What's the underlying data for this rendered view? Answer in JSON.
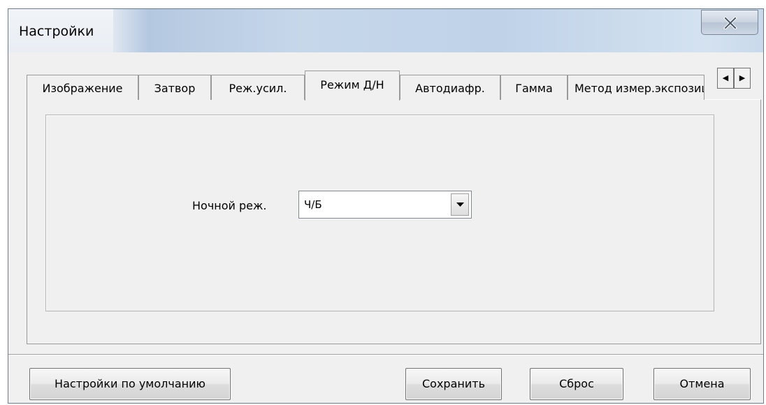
{
  "window": {
    "title": "Настройки"
  },
  "tabs": [
    {
      "label": "Изображение",
      "active": false
    },
    {
      "label": "Затвор",
      "active": false
    },
    {
      "label": "Реж.усил.",
      "active": false
    },
    {
      "label": "Режим Д/Н",
      "active": true
    },
    {
      "label": "Автодиафр.",
      "active": false
    },
    {
      "label": "Гамма",
      "active": false
    },
    {
      "label": "Метод измер.экспозиции",
      "active": false
    }
  ],
  "tab_scroll": {
    "left_glyph": "◀",
    "right_glyph": "▶"
  },
  "settings": {
    "night_mode_label": "Ночной реж.",
    "night_mode_value": "Ч/Б"
  },
  "buttons": {
    "defaults": "Настройки по умолчанию",
    "save": "Сохранить",
    "reset": "Сброс",
    "cancel": "Отмена"
  },
  "icons": {
    "close": "close-icon",
    "dropdown": "chevron-down-icon",
    "scroll_left": "arrow-left-icon",
    "scroll_right": "arrow-right-icon"
  }
}
